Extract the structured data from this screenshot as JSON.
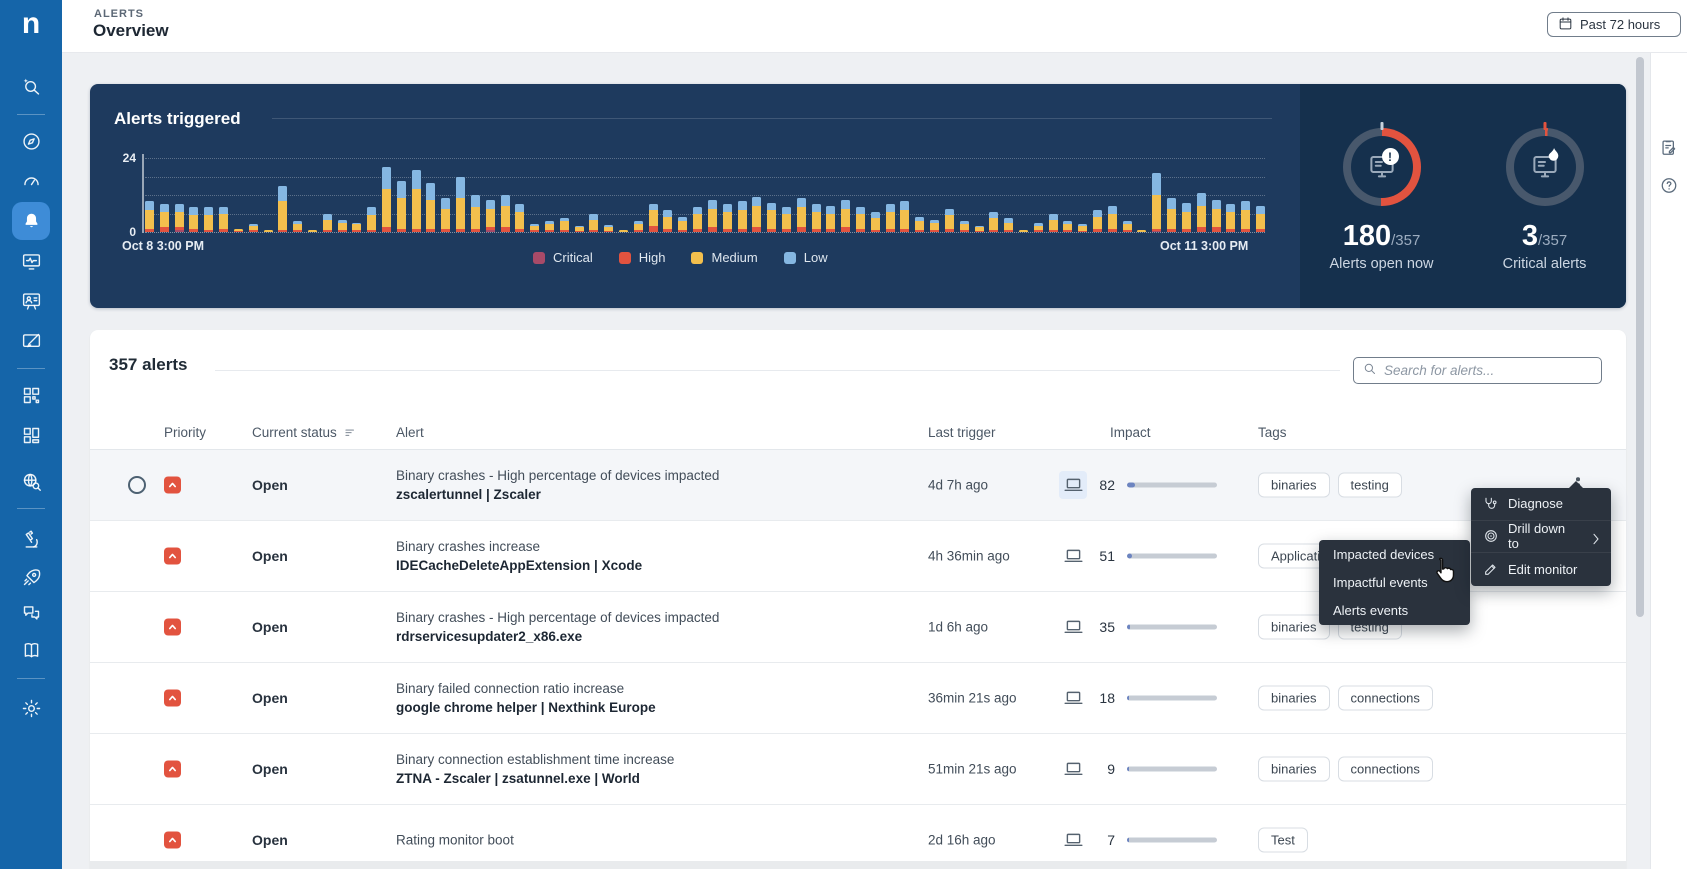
{
  "header": {
    "eyebrow": "ALERTS",
    "title": "Overview",
    "time_range": "Past 72 hours",
    "time_range_icon": "calendar-icon"
  },
  "sidebar": {
    "logo": "n",
    "active_icon": "bell",
    "icons": [
      "search-sparkle",
      "compass",
      "gauge",
      "bell",
      "monitor-pulse",
      "person-board",
      "card-edit",
      "grid",
      "layout-blocks",
      "globe-search",
      "microscope",
      "rocket",
      "chat-bubbles",
      "book",
      "gear"
    ]
  },
  "right_rail": {
    "icons": [
      "clipboard-edit",
      "help-circle"
    ]
  },
  "chart_panel": {
    "title": "Alerts triggered",
    "colors": {
      "panel": "#1e3a5e",
      "stats_panel": "#15304d",
      "gauge_red": "#e2533f",
      "gauge_track": "#48586c"
    },
    "chart_data": {
      "type": "bar",
      "stacked": true,
      "title": "Alerts triggered",
      "ylim": [
        0,
        24
      ],
      "y_ticks": [
        "24",
        "0"
      ],
      "gridlines_at": [
        6,
        12,
        18,
        24
      ],
      "x_start_label": "Oct 8 3:00 PM",
      "x_end_label": "Oct 11 3:00 PM",
      "legend": [
        "Critical",
        "High",
        "Medium",
        "Low"
      ],
      "colors": {
        "Critical": "#a84a68",
        "High": "#e2533f",
        "Medium": "#f3bf4d",
        "Low": "#85b7e2"
      },
      "series_order_bottom_to_top": [
        "Critical",
        "High",
        "Medium",
        "Low"
      ],
      "bars": [
        [
          0,
          1,
          6,
          3
        ],
        [
          0,
          1.5,
          5,
          2.5
        ],
        [
          0.5,
          1,
          5,
          2.5
        ],
        [
          0,
          1,
          4.5,
          2.5
        ],
        [
          0,
          0.5,
          5,
          2.5
        ],
        [
          0,
          1,
          5,
          2
        ],
        [
          0,
          0.3,
          0.7,
          0
        ],
        [
          0,
          0.5,
          1.5,
          0.5
        ],
        [
          0,
          0,
          0.5,
          0
        ],
        [
          0,
          0.5,
          9.5,
          5
        ],
        [
          0,
          0.5,
          2,
          1
        ],
        [
          0,
          0,
          0.5,
          0
        ],
        [
          0,
          0.5,
          3.5,
          2
        ],
        [
          0,
          0.5,
          2.5,
          1
        ],
        [
          0,
          0.5,
          2,
          0.5
        ],
        [
          0,
          0.5,
          5,
          2.5
        ],
        [
          0,
          1.5,
          12.5,
          7
        ],
        [
          0,
          1,
          10,
          5.5
        ],
        [
          0,
          1,
          13,
          6
        ],
        [
          0,
          1,
          9.5,
          5.5
        ],
        [
          0,
          1,
          6.5,
          3.5
        ],
        [
          0,
          1,
          10,
          7
        ],
        [
          0,
          1,
          7,
          4
        ],
        [
          0.5,
          1,
          6,
          3
        ],
        [
          0,
          1.5,
          7,
          3.5
        ],
        [
          0,
          1,
          5.5,
          2.5
        ],
        [
          0,
          0.5,
          1.5,
          0.5
        ],
        [
          0,
          0.5,
          2,
          1
        ],
        [
          0,
          0.5,
          3,
          1
        ],
        [
          0,
          0.3,
          1.2,
          0.5
        ],
        [
          0,
          0.5,
          3.5,
          2
        ],
        [
          0,
          0.3,
          1.4,
          0.5
        ],
        [
          0,
          0,
          0.5,
          0
        ],
        [
          0,
          0.5,
          2,
          1
        ],
        [
          0,
          2,
          5,
          2
        ],
        [
          0,
          1,
          4,
          2
        ],
        [
          0,
          0.5,
          3,
          1.5
        ],
        [
          0,
          1,
          5,
          2
        ],
        [
          0,
          1.5,
          6,
          3
        ],
        [
          0,
          1,
          5.5,
          2.5
        ],
        [
          0,
          1,
          6,
          3
        ],
        [
          0,
          1.5,
          7,
          3
        ],
        [
          0,
          1,
          6,
          2.5
        ],
        [
          0,
          1,
          5,
          2
        ],
        [
          0,
          1.5,
          6.5,
          3
        ],
        [
          0,
          1,
          5.5,
          2.5
        ],
        [
          0,
          1,
          5,
          2.5
        ],
        [
          0,
          1.5,
          6,
          3
        ],
        [
          0,
          1,
          5,
          2
        ],
        [
          0,
          0.5,
          4,
          2
        ],
        [
          0,
          1,
          5.5,
          2.5
        ],
        [
          0,
          1,
          6,
          3
        ],
        [
          0,
          0.5,
          3,
          1.5
        ],
        [
          0,
          0.5,
          2.5,
          1
        ],
        [
          0,
          1,
          4.5,
          2
        ],
        [
          0,
          0.5,
          2,
          1
        ],
        [
          0,
          0.3,
          1.2,
          0.5
        ],
        [
          0,
          0.5,
          4,
          2
        ],
        [
          0,
          0.5,
          2.5,
          1.5
        ],
        [
          0,
          0,
          0.5,
          0
        ],
        [
          0,
          0.5,
          1.5,
          1
        ],
        [
          0,
          0.5,
          3.5,
          2
        ],
        [
          0,
          0.5,
          2,
          1
        ],
        [
          0,
          0.3,
          1.5,
          0.7
        ],
        [
          0,
          1,
          4,
          2
        ],
        [
          0,
          1,
          5,
          2.5
        ],
        [
          0,
          0.5,
          2,
          1
        ],
        [
          0,
          0,
          0.5,
          0
        ],
        [
          0.3,
          0.7,
          11,
          7
        ],
        [
          0,
          1,
          6.5,
          3.5
        ],
        [
          0,
          1,
          5.5,
          3
        ],
        [
          0,
          1.5,
          7,
          4
        ],
        [
          0,
          1.5,
          6,
          3
        ],
        [
          0,
          1,
          5.5,
          2.5
        ],
        [
          0,
          1,
          6,
          3
        ],
        [
          0,
          1,
          5,
          2.5
        ]
      ]
    },
    "gauges": [
      {
        "value": "180",
        "total": "/357",
        "label": "Alerts open now",
        "pct": 50.4,
        "badge": "exclamation",
        "icon": "monitor-alert-icon",
        "tick_color": "#c7d2dd"
      },
      {
        "value": "3",
        "total": "/357",
        "label": "Critical alerts",
        "pct": 1.2,
        "badge": "flame",
        "icon": "monitor-flame-icon",
        "tick_color": "#e2533f"
      }
    ]
  },
  "table": {
    "count_label": "357 alerts",
    "search_placeholder": "Search for alerts...",
    "columns": [
      "Priority",
      "Current status",
      "Alert",
      "Last trigger",
      "Impact",
      "Tags"
    ],
    "sorted_column": "Current status",
    "rows": [
      {
        "priority": "high",
        "status": "Open",
        "title": "Binary crashes - High percentage of devices impacted",
        "subtitle": "zscalertunnel | Zscaler",
        "last_trigger": "4d 7h ago",
        "impact": 82,
        "tags": [
          "binaries",
          "testing"
        ],
        "selected": true,
        "kebab": true
      },
      {
        "priority": "high",
        "status": "Open",
        "title": "Binary crashes increase",
        "subtitle": "IDECacheDeleteAppExtension | Xcode",
        "last_trigger": "4h 36min ago",
        "impact": 51,
        "tags": [
          "Applications"
        ],
        "selected": false,
        "kebab": false
      },
      {
        "priority": "high",
        "status": "Open",
        "title": "Binary crashes - High percentage of devices impacted",
        "subtitle": "rdrservicesupdater2_x86.exe",
        "last_trigger": "1d 6h ago",
        "impact": 35,
        "tags": [
          "binaries",
          "testing"
        ],
        "selected": false,
        "kebab": false
      },
      {
        "priority": "high",
        "status": "Open",
        "title": "Binary failed connection ratio increase",
        "subtitle": "google chrome helper | Nexthink Europe",
        "last_trigger": "36min 21s ago",
        "impact": 18,
        "tags": [
          "binaries",
          "connections"
        ],
        "selected": false,
        "kebab": false
      },
      {
        "priority": "high",
        "status": "Open",
        "title": "Binary connection establishment time increase",
        "subtitle": "ZTNA - Zscaler | zsatunnel.exe | World",
        "last_trigger": "51min 21s ago",
        "impact": 9,
        "tags": [
          "binaries",
          "connections"
        ],
        "selected": false,
        "kebab": false
      },
      {
        "priority": "high",
        "status": "Open",
        "title": "Rating monitor boot",
        "subtitle": "",
        "last_trigger": "2d 16h ago",
        "impact": 7,
        "tags": [
          "Test"
        ],
        "selected": false,
        "kebab": false
      }
    ]
  },
  "context_menu": {
    "items": [
      {
        "icon": "stethoscope-icon",
        "label": "Diagnose",
        "has_submenu": false
      },
      {
        "icon": "drilldown-icon",
        "label": "Drill down to",
        "has_submenu": true
      },
      {
        "icon": "pencil-icon",
        "label": "Edit monitor",
        "has_submenu": false
      }
    ],
    "submenu": [
      "Impacted devices",
      "Impactful events",
      "Alerts events"
    ]
  }
}
